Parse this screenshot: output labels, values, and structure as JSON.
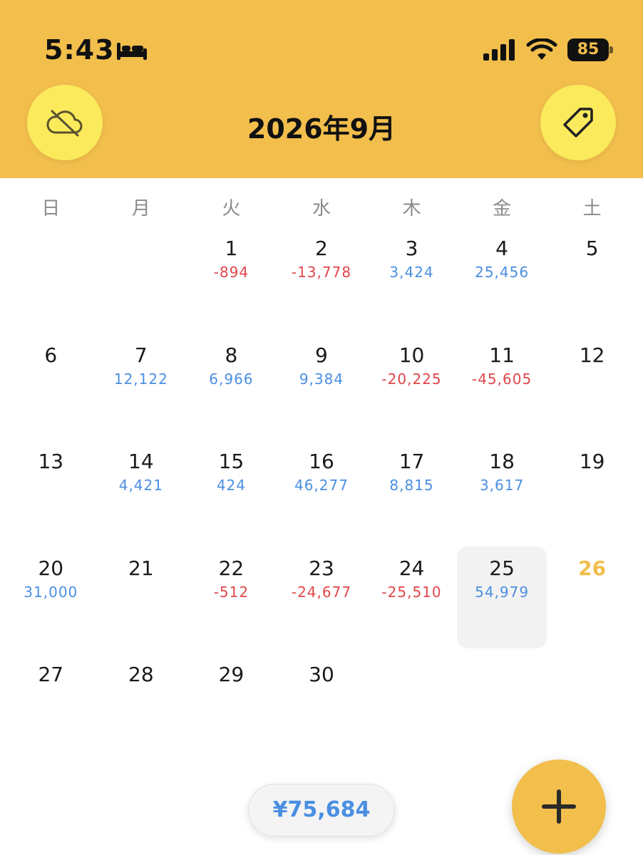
{
  "status_bar": {
    "time": "5:43",
    "battery": "85",
    "icons": [
      "bed-icon",
      "signal-icon",
      "wifi-icon",
      "battery-icon"
    ]
  },
  "header": {
    "title": "2026年9月",
    "left_button_icon": "cloud-off-icon",
    "right_button_icon": "tag-icon",
    "background": "#F2BE4C",
    "button_color": "#FBEA5C"
  },
  "weekdays": [
    "日",
    "月",
    "火",
    "水",
    "木",
    "金",
    "土"
  ],
  "calendar": {
    "weeks": [
      [
        {
          "day": "",
          "amount": ""
        },
        {
          "day": "",
          "amount": ""
        },
        {
          "day": "1",
          "amount": "-894"
        },
        {
          "day": "2",
          "amount": "-13,778"
        },
        {
          "day": "3",
          "amount": "3,424"
        },
        {
          "day": "4",
          "amount": "25,456"
        },
        {
          "day": "5",
          "amount": ""
        }
      ],
      [
        {
          "day": "6",
          "amount": ""
        },
        {
          "day": "7",
          "amount": "12,122"
        },
        {
          "day": "8",
          "amount": "6,966"
        },
        {
          "day": "9",
          "amount": "9,384"
        },
        {
          "day": "10",
          "amount": "-20,225"
        },
        {
          "day": "11",
          "amount": "-45,605"
        },
        {
          "day": "12",
          "amount": ""
        }
      ],
      [
        {
          "day": "13",
          "amount": ""
        },
        {
          "day": "14",
          "amount": "4,421"
        },
        {
          "day": "15",
          "amount": "424"
        },
        {
          "day": "16",
          "amount": "46,277"
        },
        {
          "day": "17",
          "amount": "8,815"
        },
        {
          "day": "18",
          "amount": "3,617"
        },
        {
          "day": "19",
          "amount": ""
        }
      ],
      [
        {
          "day": "20",
          "amount": "31,000"
        },
        {
          "day": "21",
          "amount": ""
        },
        {
          "day": "22",
          "amount": "-512"
        },
        {
          "day": "23",
          "amount": "-24,677"
        },
        {
          "day": "24",
          "amount": "-25,510"
        },
        {
          "day": "25",
          "amount": "54,979",
          "selected": true
        },
        {
          "day": "26",
          "amount": "",
          "today": true
        }
      ],
      [
        {
          "day": "27",
          "amount": ""
        },
        {
          "day": "28",
          "amount": ""
        },
        {
          "day": "29",
          "amount": ""
        },
        {
          "day": "30",
          "amount": ""
        },
        {
          "day": "",
          "amount": ""
        },
        {
          "day": "",
          "amount": ""
        },
        {
          "day": "",
          "amount": ""
        }
      ]
    ],
    "colors": {
      "negative": "#E0464B",
      "positive": "#4A8FE2",
      "today": "#F2BE4C"
    }
  },
  "footer": {
    "total": "¥75,684",
    "add_icon": "plus-icon"
  }
}
